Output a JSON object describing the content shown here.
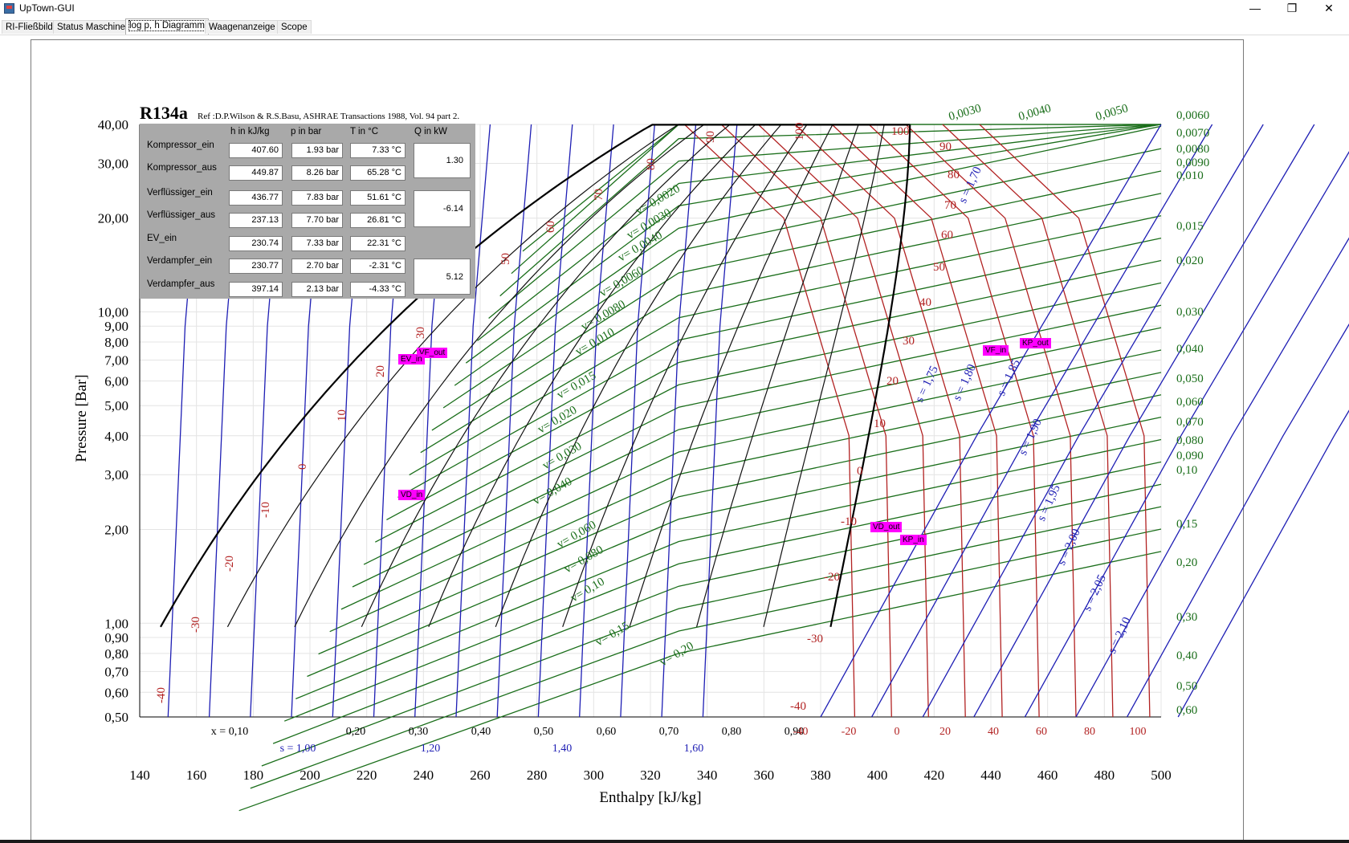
{
  "window": {
    "title": "UpTown-GUI",
    "minimize": "—",
    "restore": "❐",
    "close": "✕"
  },
  "tabs": [
    {
      "label": "RI-Fließbild"
    },
    {
      "label": "Status Maschine"
    },
    {
      "label": "log p, h Diagramm"
    },
    {
      "label": "Waagenanzeige"
    },
    {
      "label": "Scope"
    }
  ],
  "diagram": {
    "title": "R134a",
    "reference": "Ref :D.P.Wilson & R.S.Basu, ASHRAE Transactions 1988, Vol. 94 part 2.",
    "ylabel": "Pressure [Bar]",
    "xlabel": "Enthalpy [kJ/kg]",
    "y_ticks": [
      "40,00",
      "30,00",
      "20,00",
      "10,00",
      "9,00",
      "8,00",
      "7,00",
      "6,00",
      "5,00",
      "4,00",
      "3,00",
      "2,00",
      "1,00",
      "0,90",
      "0,80",
      "0,70",
      "0,60",
      "0,50"
    ],
    "x_ticks": [
      "140",
      "160",
      "180",
      "200",
      "220",
      "240",
      "260",
      "280",
      "300",
      "320",
      "340",
      "360",
      "380",
      "400",
      "420",
      "440",
      "460",
      "480",
      "500"
    ],
    "quality_labels": [
      "x = 0,10",
      "0,20",
      "0,30",
      "0,40",
      "0,50",
      "0,60",
      "0,70",
      "0,80",
      "0,90"
    ],
    "entropy_bottom_labels": [
      "s = 1,00",
      "1,20",
      "1,40",
      "1,60"
    ],
    "temp_bottom_labels": [
      "-40",
      "-20",
      "0",
      "20",
      "40",
      "60",
      "80",
      "100"
    ],
    "right_volume_labels": [
      "0,0060",
      "0,0070",
      "0,0080",
      "0,0090",
      "0,010",
      "0,015",
      "0,020",
      "0,030",
      "0,040",
      "0,050",
      "0,060",
      "0,070",
      "0,080",
      "0,090",
      "0,10",
      "0,15",
      "0,20",
      "0,30",
      "0,40",
      "0,50",
      "0,60"
    ],
    "top_volume_labels": [
      "0,0030",
      "0,0040",
      "0,0050"
    ],
    "liquid_temp_labels": [
      "-40",
      "-30",
      "-20",
      "-10",
      "0",
      "10",
      "20",
      "30",
      "50",
      "60",
      "70",
      "80",
      "90",
      "100"
    ],
    "vapor_temp_labels": [
      "100",
      "90",
      "80",
      "70",
      "60",
      "50",
      "40",
      "30",
      "20",
      "10",
      "0",
      "-10",
      "-20",
      "-30",
      "-40"
    ],
    "in_dome_volume_labels": [
      "v= 0,0020",
      "v= 0,0030",
      "v= 0,0040",
      "v= 0,0060",
      "v= 0,0080",
      "v= 0,010",
      "v= 0,015",
      "v= 0,020",
      "v= 0,030",
      "v= 0,040",
      "v= 0,060",
      "v= 0,080",
      "v= 0,10",
      "v= 0,15",
      "v= 0,20"
    ],
    "entropy_labels": [
      "s = 1,70",
      "s = 1,75",
      "s = 1,80",
      "s = 1,85",
      "s = 1,90",
      "s = 1,95",
      "s = 2,00",
      "s = 2,05",
      "s = 2,10"
    ],
    "markers": [
      "VF_out",
      "EV_in",
      "VD_in",
      "VF_in",
      "KP_out",
      "VD_out",
      "KP_in"
    ],
    "colors": {
      "saturation": "#000000",
      "isotherm": "#b22222",
      "isentrope": "#1e1eb4",
      "isochore": "#1a6e1a",
      "marker": "#ff00ff",
      "panel": "#a9a9a9"
    }
  },
  "table": {
    "headers": {
      "h": "h in kJ/kg",
      "p": "p in bar",
      "t": "T in °C",
      "q": "Q in kW"
    },
    "rows": [
      {
        "label": "Kompressor_ein",
        "h": "407.60",
        "p": "1.93 bar",
        "t": "7.33 °C"
      },
      {
        "label": "Kompressor_aus",
        "h": "449.87",
        "p": "8.26 bar",
        "t": "65.28 °C"
      },
      {
        "label": "Verflüssiger_ein",
        "h": "436.77",
        "p": "7.83 bar",
        "t": "51.61 °C"
      },
      {
        "label": "Verflüssiger_aus",
        "h": "237.13",
        "p": "7.70 bar",
        "t": "26.81 °C"
      },
      {
        "label": "EV_ein",
        "h": "230.74",
        "p": "7.33 bar",
        "t": "22.31 °C"
      },
      {
        "label": "Verdampfer_ein",
        "h": "230.77",
        "p": "2.70 bar",
        "t": "-2.31 °C"
      },
      {
        "label": "Verdampfer_aus",
        "h": "397.14",
        "p": "2.13 bar",
        "t": "-4.33 °C"
      }
    ],
    "q_values": [
      "1.30",
      "-6.14",
      "5.12"
    ]
  }
}
